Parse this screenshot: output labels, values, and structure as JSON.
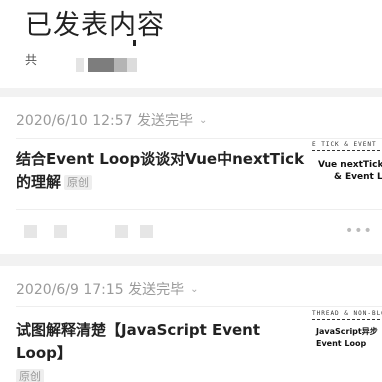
{
  "header": {
    "title": "已发表内容",
    "count_prefix": "共"
  },
  "articles": [
    {
      "meta": "2020/6/10 12:57 发送完毕",
      "title": "结合Event Loop谈谈对Vue中nextTick的理解",
      "badge": "原创",
      "thumb": {
        "strip": "E TICK & EVENT",
        "line1": "Vue nextTick",
        "line2": "& Event L"
      },
      "more": "•••"
    },
    {
      "meta": "2020/6/9 17:15 发送完毕",
      "title": "试图解释清楚【JavaScript Event Loop】",
      "badge": "原创",
      "thumb": {
        "strip": "THREAD & NON-BLO",
        "line1": "JavaScript异步",
        "line2": "Event Loop"
      }
    }
  ],
  "colors": {
    "background": "#ffffff",
    "section_gap": "#f2f2f2",
    "meta_text": "#9a9a9a",
    "title_text": "#222222"
  },
  "icons": [
    "chevron-down-icon",
    "more-dots-icon"
  ]
}
